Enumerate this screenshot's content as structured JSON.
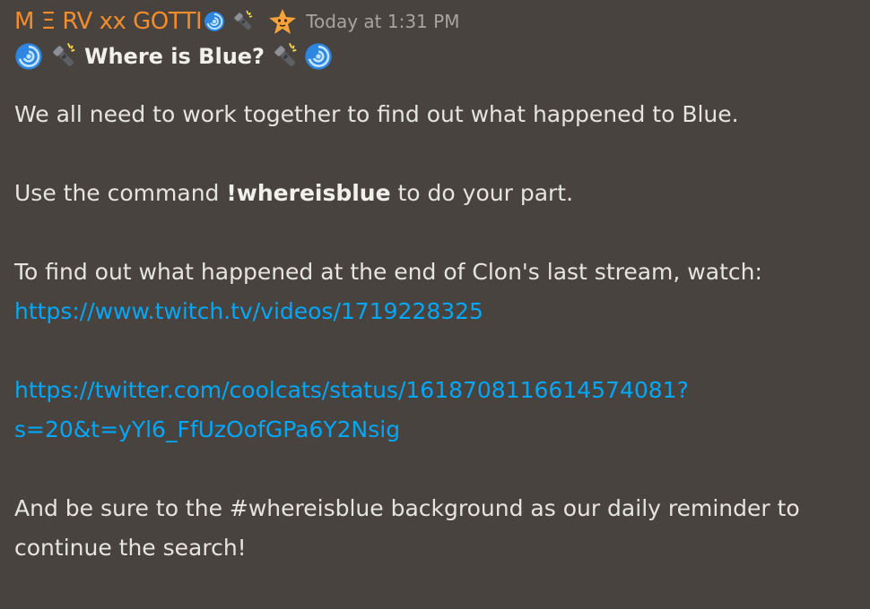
{
  "message": {
    "author": "M Ξ RV xx GOTTI",
    "author_icons": [
      "cyclone-icon",
      "flashlight-icon"
    ],
    "badge_icon": "starfish-icon",
    "timestamp": "Today at 1:31 PM",
    "title": {
      "text": "Where is Blue?",
      "left_icons": [
        "cyclone-icon",
        "flashlight-icon"
      ],
      "right_icons": [
        "flashlight-icon",
        "cyclone-icon"
      ]
    },
    "para1": "We all need to work together to find out what happened to Blue.",
    "para2": {
      "before": "Use the command ",
      "command": "!whereisblue",
      "after": " to do your part."
    },
    "para3": {
      "text": "To find out what happened at the end of Clon's last stream, watch:",
      "link": "https://www.twitch.tv/videos/1719228325"
    },
    "para4": {
      "link_line1": "https://twitter.com/coolcats/status/1618708116614574081?",
      "link_line2": "s=20&t=yYl6_FfUzOofGPa6Y2Nsig"
    },
    "para5": {
      "line1": "And be sure to the #whereisblue background as our daily reminder to",
      "line2": "continue the search!"
    }
  },
  "colors": {
    "background": "#48433e",
    "username": "#f38d2c",
    "link": "#00a8fc",
    "text": "#e6e4df",
    "timestamp": "#a9a49d"
  }
}
